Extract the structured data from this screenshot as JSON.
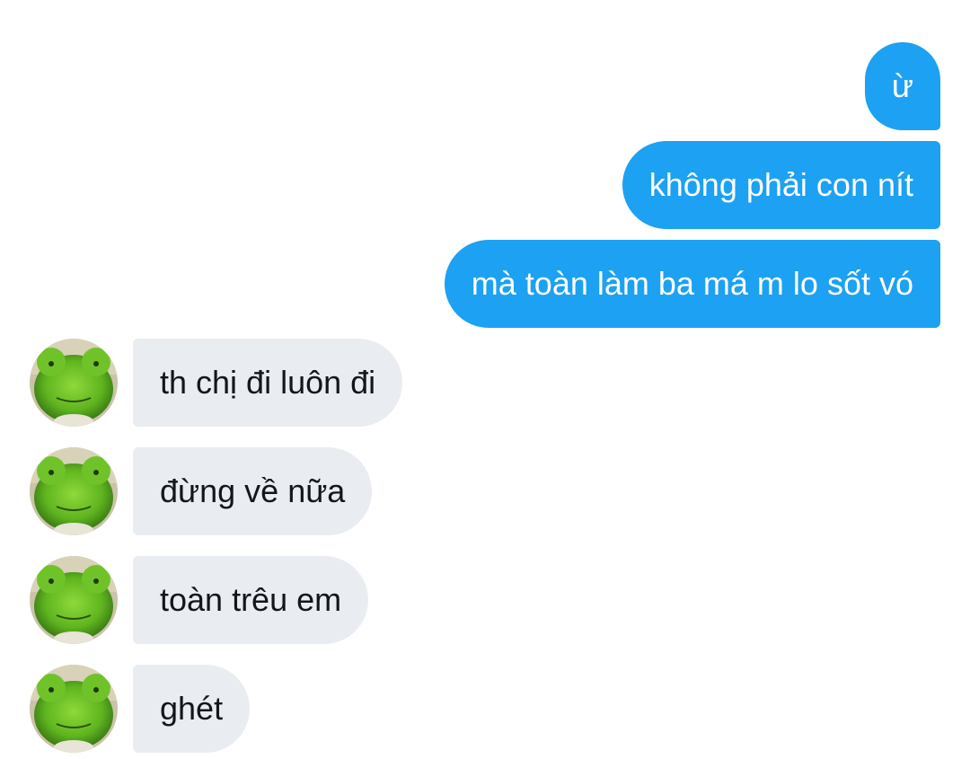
{
  "conversation": {
    "outgoing": [
      {
        "text": "ừ"
      },
      {
        "text": "không phải con nít"
      },
      {
        "text": "mà toàn làm ba má m lo sốt vó"
      }
    ],
    "incoming": [
      {
        "text": "th chị đi luôn đi",
        "avatar_icon": "green-frog-plush-avatar-icon"
      },
      {
        "text": "đừng về nữa",
        "avatar_icon": "green-frog-plush-avatar-icon"
      },
      {
        "text": "toàn trêu em",
        "avatar_icon": "green-frog-plush-avatar-icon"
      },
      {
        "text": "ghét",
        "avatar_icon": "green-frog-plush-avatar-icon"
      }
    ]
  },
  "colors": {
    "outgoing_bubble": "#1da1f2",
    "incoming_bubble": "#e9ecf0",
    "incoming_text": "#14171a",
    "outgoing_text": "#ffffff"
  }
}
